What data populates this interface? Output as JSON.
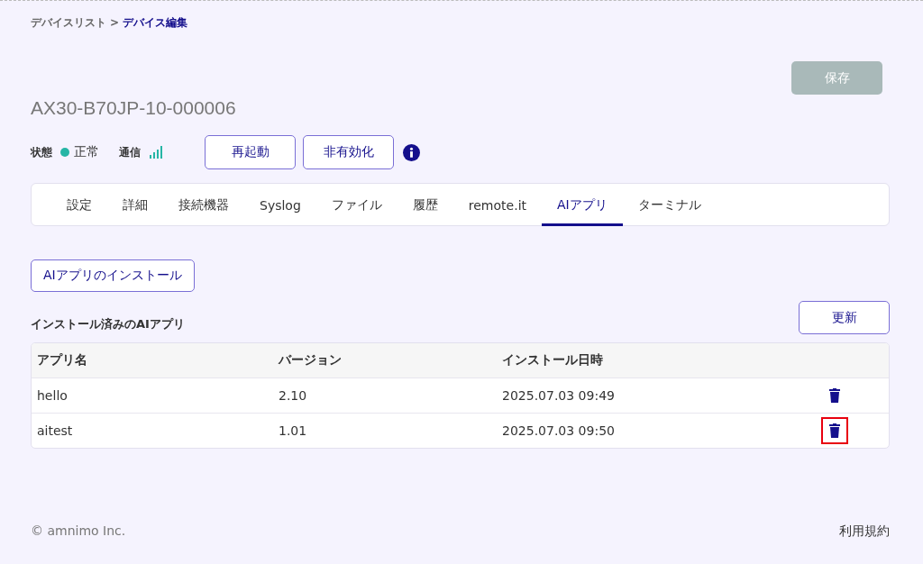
{
  "breadcrumb": {
    "parent": "デバイスリスト",
    "separator": ">",
    "current": "デバイス編集"
  },
  "save_button": {
    "label": "保存",
    "disabled": true
  },
  "device": {
    "name": "AX30-B70JP-10-000006",
    "status_label": "状態",
    "status": "正常",
    "signal_label": "通信"
  },
  "actions": [
    "再起動",
    "非有効化"
  ],
  "tabs": [
    {
      "label": "設定",
      "selected": false
    },
    {
      "label": "詳細",
      "selected": false
    },
    {
      "label": "接続機器",
      "selected": false
    },
    {
      "label": "Syslog",
      "selected": false
    },
    {
      "label": "ファイル",
      "selected": false
    },
    {
      "label": "履歴",
      "selected": false
    },
    {
      "label": "remote.it",
      "selected": false
    },
    {
      "label": "AIアプリ",
      "selected": true
    },
    {
      "label": "ターミナル",
      "selected": false
    }
  ],
  "install_button": "AIアプリのインストール",
  "section_title": "インストール済みのAIアプリ",
  "refresh_button": "更新",
  "table": {
    "columns": [
      "アプリ名",
      "バージョン",
      "インストール日時"
    ],
    "rows": [
      {
        "cells": [
          "hello",
          "2.10",
          "2025.07.03 09:49"
        ],
        "highlighted": false
      },
      {
        "cells": [
          "aitest",
          "1.01",
          "2025.07.03 09:50"
        ],
        "highlighted": true
      }
    ]
  },
  "footer": {
    "copyright": "© amnimo Inc.",
    "terms": "利用規約"
  }
}
